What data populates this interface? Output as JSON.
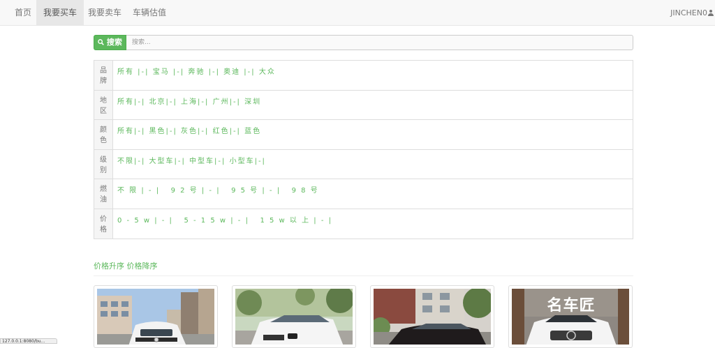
{
  "nav": {
    "items": [
      {
        "label": "首页"
      },
      {
        "label": "我要买车"
      },
      {
        "label": "我要卖车"
      },
      {
        "label": "车辆估值"
      }
    ],
    "user": "JINCHEN0"
  },
  "search": {
    "button_label": "搜索",
    "placeholder": "搜索..."
  },
  "filters": [
    {
      "label": [
        "品",
        "牌"
      ],
      "options": "所有 |-| 宝马 |-| 奔驰 |-| 奥迪 |-| 大众"
    },
    {
      "label": [
        "地",
        "区"
      ],
      "options": "所有|-| 北京|-| 上海|-| 广州|-| 深圳"
    },
    {
      "label": [
        "颜",
        "色"
      ],
      "options": "所有|-| 黑色|-| 灰色|-| 红色|-| 蓝色"
    },
    {
      "label": [
        "级",
        "别"
      ],
      "options": "不限|-| 大型车|-| 中型车|-| 小型车|-|"
    },
    {
      "label": [
        "燃",
        "油"
      ],
      "options": "不 限 | - |   9 2 号 | - |   9 5 号 | - |   9 8 号"
    },
    {
      "label": [
        "价",
        "格"
      ],
      "options": "0 - 5 w | - |   5 - 1 5 w | - |   1 5 w 以 上 | - |"
    }
  ],
  "sort": {
    "asc": "价格升序",
    "desc": "价格降序"
  },
  "cards": [
    {
      "icon": "car-photo-white-volkswagen"
    },
    {
      "icon": "car-photo-white-bmw"
    },
    {
      "icon": "car-photo-black-sedan"
    },
    {
      "icon": "car-photo-white-mercedes",
      "banner": "名车匠"
    }
  ],
  "status_bar": "127.0.0.1:8080/bu..."
}
